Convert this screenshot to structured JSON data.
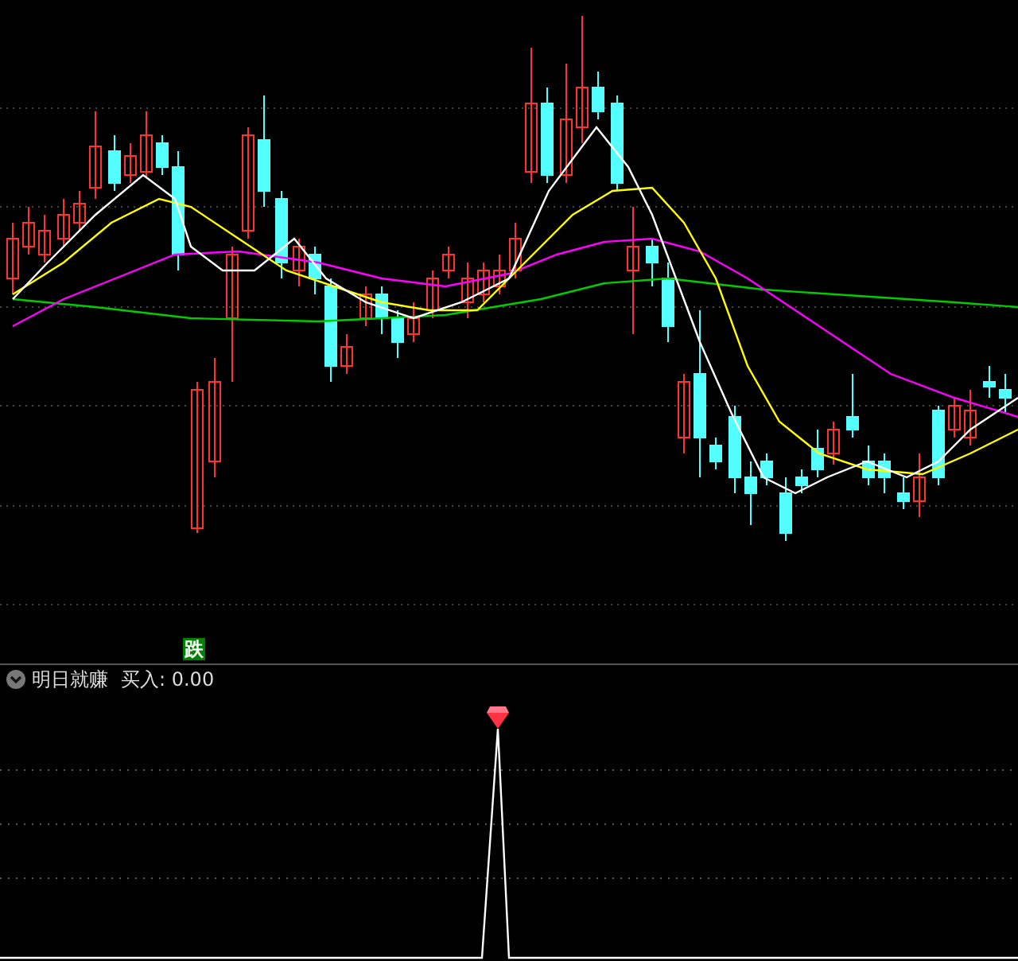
{
  "main_chart": {
    "signal_badge": "跌"
  },
  "indicator_panel": {
    "expanded": true,
    "name": "明日就赚",
    "reading": "买入: 0.00"
  }
}
